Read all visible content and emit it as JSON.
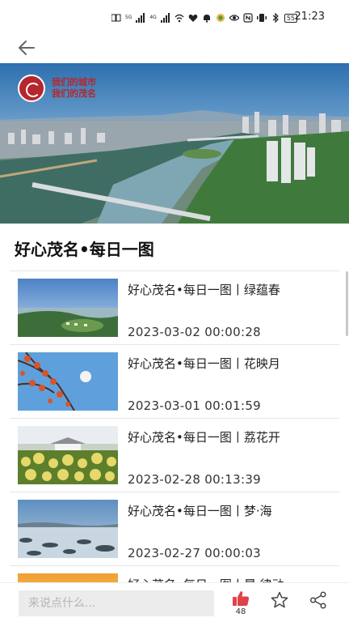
{
  "status_bar": {
    "network_1": "5G",
    "network_2": "4G",
    "battery": "55",
    "time": "21:23",
    "icons": [
      "hd-signal-icon",
      "signal-icon",
      "signal-icon",
      "wifi-icon",
      "heart-icon",
      "bell-icon",
      "app-icon",
      "eye-icon",
      "nfc-icon",
      "vibrate-icon",
      "bluetooth-icon",
      "battery-icon"
    ]
  },
  "nav": {
    "back_icon": "back-arrow-icon"
  },
  "banner": {
    "logo_line1": "我们的城市",
    "logo_line2": "我们的茂名"
  },
  "section_title": "好心茂名•每日一图",
  "articles": [
    {
      "title": "好心茂名•每日一图丨绿蕴春",
      "date": "2023-03-02 00:00:28"
    },
    {
      "title": "好心茂名•每日一图丨花映月",
      "date": "2023-03-01 00:01:59"
    },
    {
      "title": "好心茂名•每日一图丨荔花开",
      "date": "2023-02-28 00:13:39"
    },
    {
      "title": "好心茂名•每日一图丨梦·海",
      "date": "2023-02-27 00:00:03"
    },
    {
      "title": "好心茂名•每日一图丨晨·律动",
      "date": ""
    }
  ],
  "bottom_bar": {
    "comment_placeholder": "来说点什么...",
    "like_count": "48",
    "like_icon": "thumbs-up-icon",
    "favorite_icon": "star-icon",
    "share_icon": "share-icon",
    "accent_color": "#e0424a"
  }
}
